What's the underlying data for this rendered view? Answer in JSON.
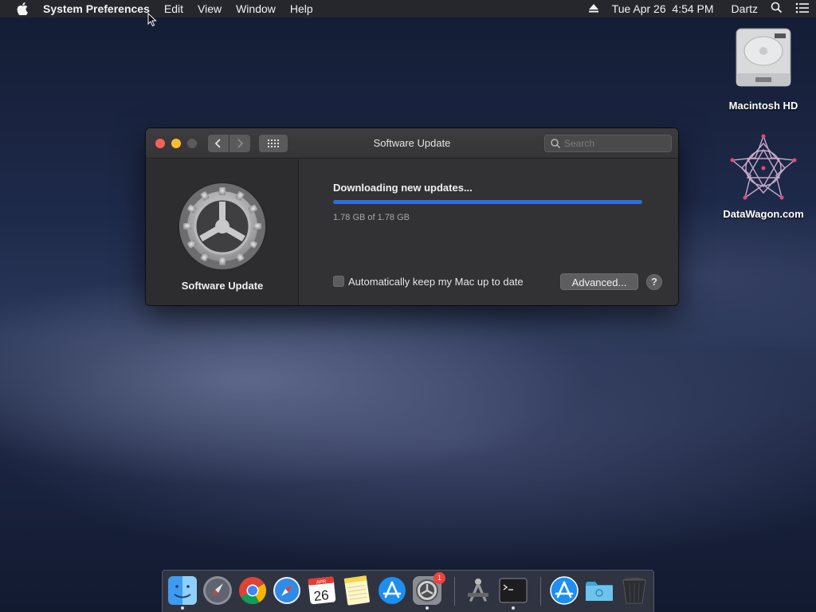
{
  "menubar": {
    "app_name": "System Preferences",
    "menus": [
      "Edit",
      "View",
      "Window",
      "Help"
    ],
    "clock": "Tue Apr 26  4:54 PM",
    "user": "Dartz"
  },
  "desktop": {
    "icons": [
      {
        "label": "Macintosh HD"
      },
      {
        "label": "DataWagon.com"
      }
    ]
  },
  "window": {
    "title": "Software Update",
    "search_placeholder": "Search",
    "sidebar_title": "Software Update",
    "status_title": "Downloading new updates...",
    "progress_text": "1.78 GB of 1.78 GB",
    "progress_fraction": 1.0,
    "auto_update_label": "Automatically keep my Mac up to date",
    "auto_update_checked": false,
    "advanced_label": "Advanced...",
    "help_label": "?"
  },
  "dock": {
    "system_preferences_badge": "1",
    "calendar_month": "APR",
    "calendar_day": "26"
  },
  "colors": {
    "close": "#fc5f57",
    "minimize": "#fdbc2e",
    "progress": "#2f6ee0",
    "badge": "#f0413a"
  }
}
